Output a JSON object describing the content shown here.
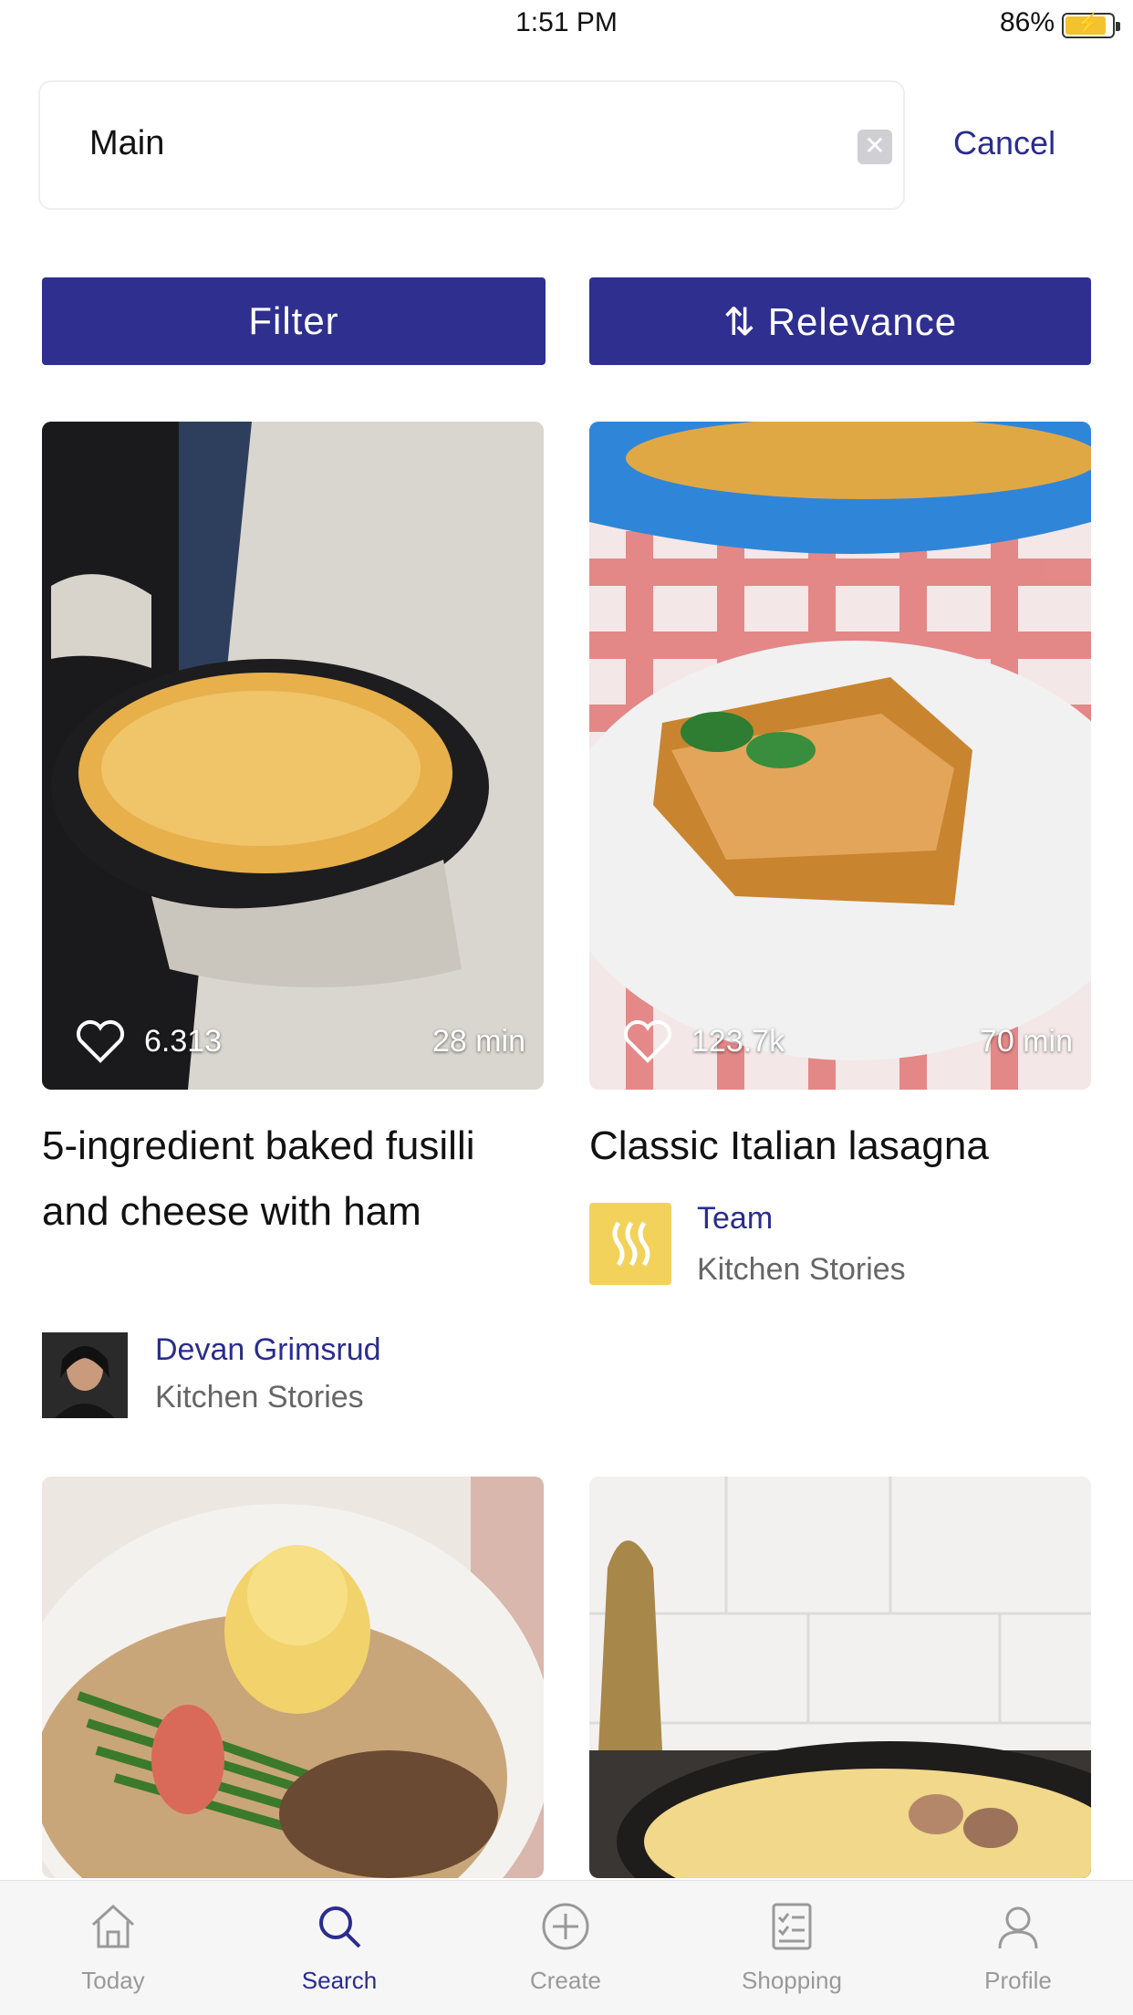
{
  "status_bar": {
    "time": "1:51 PM",
    "battery": "86%",
    "battery_level": 0.86
  },
  "search": {
    "query": "Main",
    "cancel_label": "Cancel"
  },
  "toolbar": {
    "filter_label": "Filter",
    "sort_label": "⇅ Relevance"
  },
  "recipes": [
    {
      "likes": "6.313",
      "time": "28 min",
      "title": "5-ingredient baked fusilli and cheese with ham",
      "author": "Devan Grimsrud",
      "source": "Kitchen Stories"
    },
    {
      "likes": "123.7k",
      "time": "70 min",
      "title": "Classic Italian lasagna",
      "author": "Team",
      "source": "Kitchen Stories"
    },
    {
      "likes": "",
      "time": "",
      "title": "",
      "author": "",
      "source": ""
    },
    {
      "likes": "",
      "time": "",
      "title": "",
      "author": "",
      "source": ""
    }
  ],
  "bottom_nav": [
    {
      "label": "Today",
      "icon": "home-icon"
    },
    {
      "label": "Search",
      "icon": "search-icon",
      "active": true
    },
    {
      "label": "Create",
      "icon": "plus-circle-icon"
    },
    {
      "label": "Shopping",
      "icon": "checklist-icon"
    },
    {
      "label": "Profile",
      "icon": "profile-icon"
    }
  ],
  "colors": {
    "accent": "#2e2f8f",
    "link": "#2a2c8e",
    "badge_yellow": "#f2d25a"
  }
}
